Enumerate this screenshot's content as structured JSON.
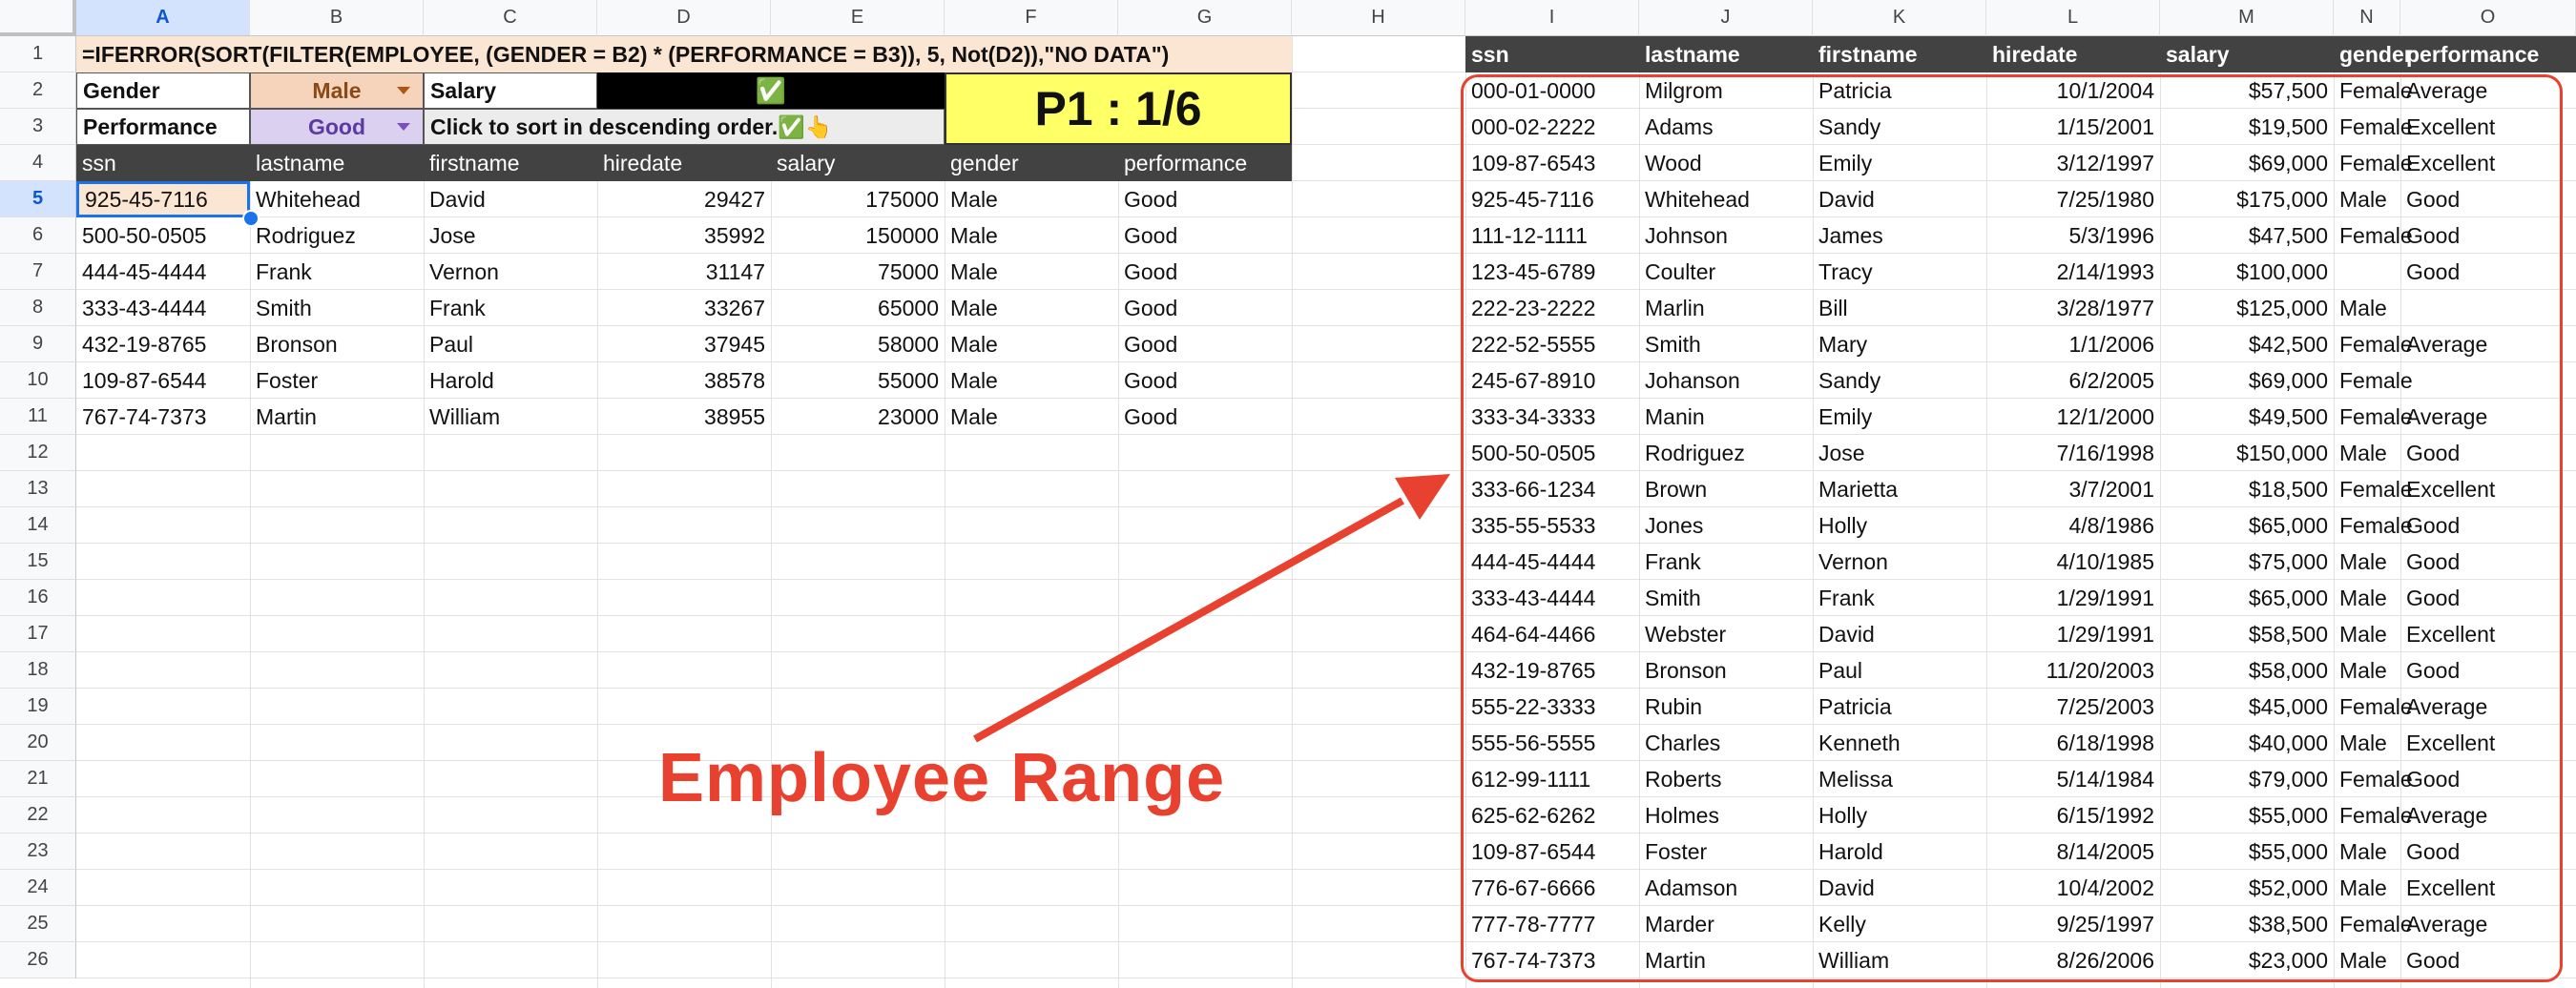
{
  "columns": [
    "A",
    "B",
    "C",
    "D",
    "E",
    "F",
    "G",
    "H",
    "I",
    "J",
    "K",
    "L",
    "M",
    "N",
    "O"
  ],
  "rows": [
    "1",
    "2",
    "3",
    "4",
    "5",
    "6",
    "7",
    "8",
    "9",
    "10",
    "11",
    "12",
    "13",
    "14",
    "15",
    "16",
    "17",
    "18",
    "19",
    "20",
    "21",
    "22",
    "23",
    "24",
    "25",
    "26"
  ],
  "selected_cell": {
    "column": "A",
    "row": "5"
  },
  "formula_text": "=IFERROR(SORT(FILTER(EMPLOYEE, (GENDER = B2) * (PERFORMANCE = B3)), 5, Not(D2)),\"NO DATA\")",
  "controls": {
    "gender_label": "Gender",
    "gender_value": "Male",
    "performance_label": "Performance",
    "performance_value": "Good",
    "salary_label": "Salary",
    "checkbox_glyph": "✅",
    "sort_hint": "Click to sort in descending order.✅👆",
    "page_indicator": "P1 : 1/6"
  },
  "colors": {
    "gender_fill": "#f6d3bb",
    "gender_text": "#8a4a17",
    "performance_fill": "#dcd0f0",
    "performance_text": "#5b3aa2",
    "page_fill": "#ffff66",
    "accent_red": "#e8412f",
    "header_fill": "#424242"
  },
  "result_table": {
    "headers": [
      "ssn",
      "lastname",
      "firstname",
      "hiredate",
      "salary",
      "gender",
      "performance"
    ],
    "rows": [
      [
        "925-45-7116",
        "Whitehead",
        "David",
        "29427",
        "175000",
        "Male",
        "Good"
      ],
      [
        "500-50-0505",
        "Rodriguez",
        "Jose",
        "35992",
        "150000",
        "Male",
        "Good"
      ],
      [
        "444-45-4444",
        "Frank",
        "Vernon",
        "31147",
        "75000",
        "Male",
        "Good"
      ],
      [
        "333-43-4444",
        "Smith",
        "Frank",
        "33267",
        "65000",
        "Male",
        "Good"
      ],
      [
        "432-19-8765",
        "Bronson",
        "Paul",
        "37945",
        "58000",
        "Male",
        "Good"
      ],
      [
        "109-87-6544",
        "Foster",
        "Harold",
        "38578",
        "55000",
        "Male",
        "Good"
      ],
      [
        "767-74-7373",
        "Martin",
        "William",
        "38955",
        "23000",
        "Male",
        "Good"
      ]
    ]
  },
  "employee_table": {
    "headers": [
      "ssn",
      "lastname",
      "firstname",
      "hiredate",
      "salary",
      "gender",
      "performance"
    ],
    "rows": [
      [
        "000-01-0000",
        "Milgrom",
        "Patricia",
        "10/1/2004",
        "$57,500",
        "Female",
        "Average"
      ],
      [
        "000-02-2222",
        "Adams",
        "Sandy",
        "1/15/2001",
        "$19,500",
        "Female",
        "Excellent"
      ],
      [
        "109-87-6543",
        "Wood",
        "Emily",
        "3/12/1997",
        "$69,000",
        "Female",
        "Excellent"
      ],
      [
        "925-45-7116",
        "Whitehead",
        "David",
        "7/25/1980",
        "$175,000",
        "Male",
        "Good"
      ],
      [
        "111-12-1111",
        "Johnson",
        "James",
        "5/3/1996",
        "$47,500",
        "Female",
        "Good"
      ],
      [
        "123-45-6789",
        "Coulter",
        "Tracy",
        "2/14/1993",
        "$100,000",
        "",
        "Good"
      ],
      [
        "222-23-2222",
        "Marlin",
        "Bill",
        "3/28/1977",
        "$125,000",
        "Male",
        ""
      ],
      [
        "222-52-5555",
        "Smith",
        "Mary",
        "1/1/2006",
        "$42,500",
        "Female",
        "Average"
      ],
      [
        "245-67-8910",
        "Johanson",
        "Sandy",
        "6/2/2005",
        "$69,000",
        "Female",
        ""
      ],
      [
        "333-34-3333",
        "Manin",
        "Emily",
        "12/1/2000",
        "$49,500",
        "Female",
        "Average"
      ],
      [
        "500-50-0505",
        "Rodriguez",
        "Jose",
        "7/16/1998",
        "$150,000",
        "Male",
        "Good"
      ],
      [
        "333-66-1234",
        "Brown",
        "Marietta",
        "3/7/2001",
        "$18,500",
        "Female",
        "Excellent"
      ],
      [
        "335-55-5533",
        "Jones",
        "Holly",
        "4/8/1986",
        "$65,000",
        "Female",
        "Good"
      ],
      [
        "444-45-4444",
        "Frank",
        "Vernon",
        "4/10/1985",
        "$75,000",
        "Male",
        "Good"
      ],
      [
        "333-43-4444",
        "Smith",
        "Frank",
        "1/29/1991",
        "$65,000",
        "Male",
        "Good"
      ],
      [
        "464-64-4466",
        "Webster",
        "David",
        "1/29/1991",
        "$58,500",
        "Male",
        "Excellent"
      ],
      [
        "432-19-8765",
        "Bronson",
        "Paul",
        "11/20/2003",
        "$58,000",
        "Male",
        "Good"
      ],
      [
        "555-22-3333",
        "Rubin",
        "Patricia",
        "7/25/2003",
        "$45,000",
        "Female",
        "Average"
      ],
      [
        "555-56-5555",
        "Charles",
        "Kenneth",
        "6/18/1998",
        "$40,000",
        "Male",
        "Excellent"
      ],
      [
        "612-99-1111",
        "Roberts",
        "Melissa",
        "5/14/1984",
        "$79,000",
        "Female",
        "Good"
      ],
      [
        "625-62-6262",
        "Holmes",
        "Holly",
        "6/15/1992",
        "$55,000",
        "Female",
        "Average"
      ],
      [
        "109-87-6544",
        "Foster",
        "Harold",
        "8/14/2005",
        "$55,000",
        "Male",
        "Good"
      ],
      [
        "776-67-6666",
        "Adamson",
        "David",
        "10/4/2002",
        "$52,000",
        "Male",
        "Excellent"
      ],
      [
        "777-78-7777",
        "Marder",
        "Kelly",
        "9/25/1997",
        "$38,500",
        "Female",
        "Average"
      ],
      [
        "767-74-7373",
        "Martin",
        "William",
        "8/26/2006",
        "$23,000",
        "Male",
        "Good"
      ]
    ]
  },
  "annotation": {
    "label": "Employee Range"
  }
}
